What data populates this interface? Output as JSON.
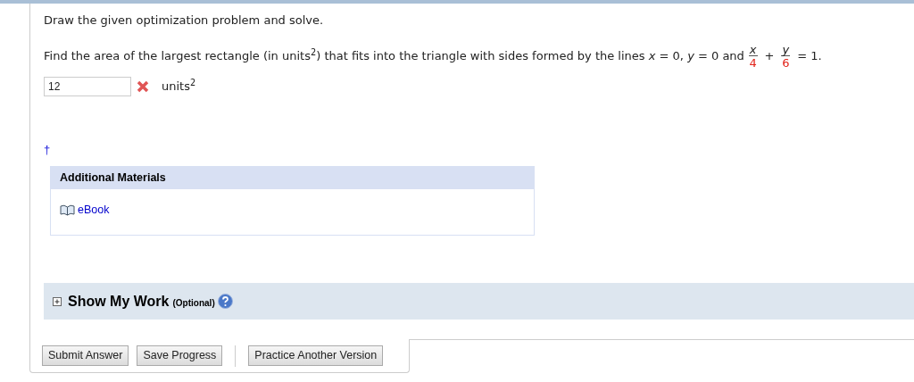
{
  "instruction": "Draw the given optimization problem and solve.",
  "question": {
    "text": "Find the area of the largest rectangle (in units$^{2}$) that fits into the triangle with sides formed by the lines *x* = 0, *y* = 0 and",
    "terms": [
      {
        "num": "x",
        "den": "4"
      },
      {
        "num": "y",
        "den": "6"
      }
    ],
    "operator": "+",
    "result": "= 1."
  },
  "answer": {
    "value": "12",
    "correct": false,
    "units": "units$^{2}$"
  },
  "footnote_mark": "†",
  "materials": {
    "title": "Additional Materials",
    "items": [
      {
        "label": "eBook"
      }
    ]
  },
  "show_my_work": {
    "title": "Show My Work",
    "note": "(Optional)",
    "expanded": false
  },
  "button_groups": [
    [
      "Submit Answer",
      "Save Progress"
    ],
    [
      "Practice Another Version"
    ]
  ]
}
